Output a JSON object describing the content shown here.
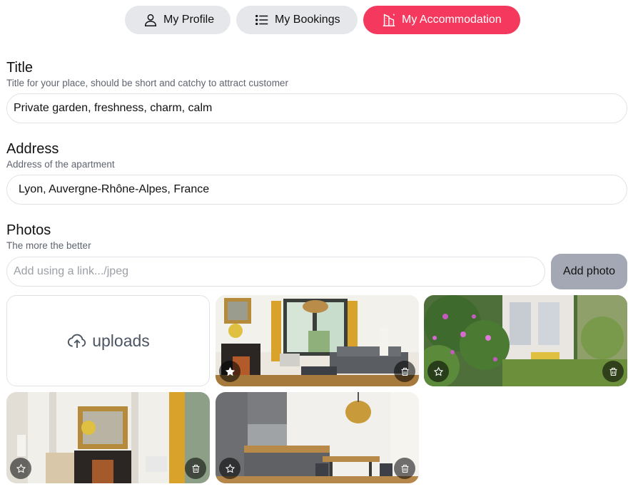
{
  "nav": {
    "profile": "My Profile",
    "bookings": "My Bookings",
    "accommodation": "My Accommodation",
    "accent_color": "#f5385d"
  },
  "title": {
    "heading": "Title",
    "hint": "Title for your place, should be short and catchy to attract customer",
    "value": "Private garden, freshness, charm, calm"
  },
  "address": {
    "heading": "Address",
    "hint": "Address of the apartment",
    "value": "Lyon, Auvergne-Rhône-Alpes, France"
  },
  "photos": {
    "heading": "Photos",
    "hint": "The more the better",
    "link_placeholder": "Add using a link.../jpeg",
    "add_button": "Add photo",
    "upload_label": "uploads",
    "items": [
      {
        "scene": "living-room-fireplace",
        "main": true
      },
      {
        "scene": "garden-flowers",
        "main": false
      },
      {
        "scene": "living-room-mirror",
        "main": false
      },
      {
        "scene": "kitchen-dining",
        "main": false
      }
    ]
  }
}
